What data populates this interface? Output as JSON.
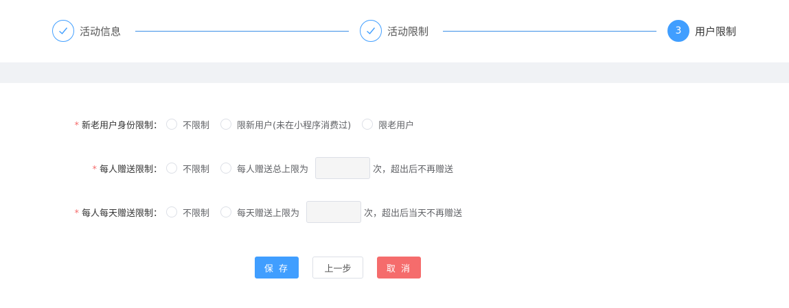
{
  "steps": [
    {
      "label": "活动信息",
      "state": "done",
      "icon": "check-icon"
    },
    {
      "label": "活动限制",
      "state": "done",
      "icon": "check-icon"
    },
    {
      "label": "用户限制",
      "state": "current",
      "number": "3"
    }
  ],
  "colors": {
    "primary": "#409eff",
    "danger": "#f56c6c",
    "band": "#f0f2f5"
  },
  "form": {
    "identity": {
      "required_mark": "*",
      "label": "新老用户身份限制：",
      "options": [
        "不限制",
        "限新用户(未在小程序消费过)",
        "限老用户"
      ]
    },
    "per_person": {
      "required_mark": "*",
      "label": "每人赠送限制：",
      "options": [
        "不限制",
        "每人赠送总上限为"
      ],
      "input_value": "",
      "suffix": "次，超出后不再赠送"
    },
    "per_person_day": {
      "required_mark": "*",
      "label": "每人每天赠送限制：",
      "options": [
        "不限制",
        "每天赠送上限为"
      ],
      "input_value": "",
      "suffix": "次，超出后当天不再赠送"
    }
  },
  "buttons": {
    "save": "保 存",
    "prev": "上一步",
    "cancel": "取 消"
  }
}
